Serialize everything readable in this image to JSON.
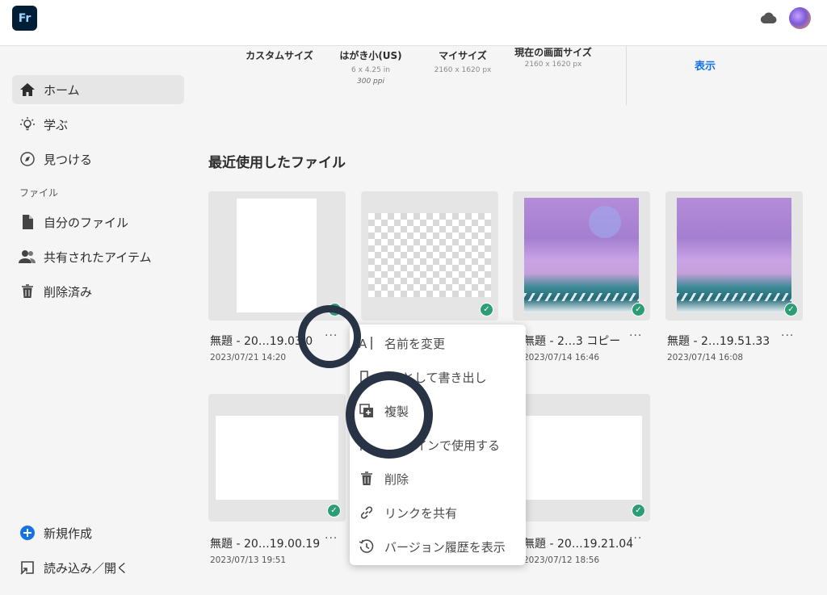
{
  "app": {
    "logo_text": "Fr",
    "accent": "#1473e6",
    "cloud_icon": "cloud-icon"
  },
  "sidebar": {
    "items": [
      {
        "label": "ホーム",
        "icon": "home-icon",
        "active": true
      },
      {
        "label": "学ぶ",
        "icon": "lightbulb-icon"
      },
      {
        "label": "見つける",
        "icon": "compass-icon"
      }
    ],
    "section_label": "ファイル",
    "file_items": [
      {
        "label": "自分のファイル",
        "icon": "document-icon"
      },
      {
        "label": "共有されたアイテム",
        "icon": "people-icon"
      },
      {
        "label": "削除済み",
        "icon": "trash-icon"
      }
    ],
    "new_label": "新規作成",
    "import_label": "読み込み／開く"
  },
  "sizes": [
    {
      "title": "カスタムサイズ",
      "sub": "",
      "ppi": ""
    },
    {
      "title": "はがき小(US)",
      "sub": "6 x 4.25 in",
      "ppi": "300 ppi"
    },
    {
      "title": "マイサイズ",
      "sub": "2160 x 1620 px",
      "ppi": ""
    },
    {
      "title": "現在の画面サイズ",
      "sub": "2160 x 1620 px",
      "ppi": ""
    }
  ],
  "show_label": "表示",
  "recent_title": "最近使用したファイル",
  "files": [
    {
      "name": "無題 - 20…19.03.0",
      "date": "2023/07/21 14:20"
    },
    {
      "name": "",
      "date": ""
    },
    {
      "name": "無題 - 2…3 コピー",
      "date": "2023/07/14 16:46"
    },
    {
      "name": "無題 - 2…19.51.33",
      "date": "2023/07/14 16:08"
    },
    {
      "name": "無題 - 20…19.00.19",
      "date": "2023/07/13 19:51"
    },
    {
      "name": "無題 - 20…19.21.04",
      "date": "2023/07/12 18:56"
    }
  ],
  "more_label": "···",
  "context_menu": [
    {
      "label": "名前を変更",
      "icon": "rename-icon"
    },
    {
      "label": "として書き出し",
      "icon": "export-icon"
    },
    {
      "label": "複製",
      "icon": "duplicate-icon"
    },
    {
      "label": "インで使用する",
      "icon": "online-use-icon"
    },
    {
      "label": "削除",
      "icon": "trash-icon"
    },
    {
      "label": "リンクを共有",
      "icon": "link-icon"
    },
    {
      "label": "バージョン履歴を表示",
      "icon": "history-icon"
    }
  ],
  "sync_status": "synced",
  "colors": {
    "check": "#2d9d78",
    "annotation_ring": "#283345"
  }
}
